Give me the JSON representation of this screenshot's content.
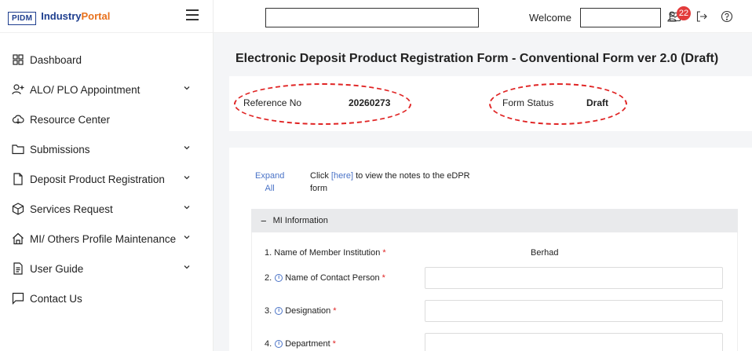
{
  "brand": {
    "logo_prefix": "PIDM",
    "name_part1": "Industry",
    "name_part2": "Portal"
  },
  "header": {
    "welcome_label": "Welcome",
    "notification_count": "22"
  },
  "sidebar": {
    "items": [
      {
        "label": "Dashboard",
        "icon": "grid-icon",
        "has_chevron": false
      },
      {
        "label": "ALO/ PLO Appointment",
        "icon": "add-user-icon",
        "has_chevron": true
      },
      {
        "label": "Resource Center",
        "icon": "cloud-icon",
        "has_chevron": false
      },
      {
        "label": "Submissions",
        "icon": "folder-icon",
        "has_chevron": true
      },
      {
        "label": "Deposit Product Registration",
        "icon": "file-icon",
        "has_chevron": true
      },
      {
        "label": "Services Request",
        "icon": "cube-icon",
        "has_chevron": true
      },
      {
        "label": "MI/ Others Profile Maintenance",
        "icon": "home-icon",
        "has_chevron": true
      },
      {
        "label": "User Guide",
        "icon": "document-icon",
        "has_chevron": true
      },
      {
        "label": "Contact Us",
        "icon": "message-icon",
        "has_chevron": false
      }
    ]
  },
  "main": {
    "title": "Electronic Deposit Product Registration Form - Conventional Form ver 2.0 (Draft)",
    "reference_label": "Reference No",
    "reference_value": "20260273",
    "form_status_label": "Form Status",
    "form_status_value": "Draft",
    "expand_label_1": "Expand",
    "expand_label_2": "All",
    "notes_pre": "Click ",
    "notes_link": "[here]",
    "notes_post": " to view the notes to the eDPR form",
    "section_title": "MI Information",
    "fields": [
      {
        "num": "1.",
        "label": "Name of Member Institution",
        "value": "Berhad",
        "has_info": false
      },
      {
        "num": "2.",
        "label": "Name of Contact Person",
        "value": "",
        "has_info": true
      },
      {
        "num": "3.",
        "label": "Designation",
        "value": "",
        "has_info": true
      },
      {
        "num": "4.",
        "label": "Department",
        "value": "",
        "has_info": true
      }
    ],
    "required_mark": "*"
  },
  "colors": {
    "brand_blue": "#1f3f8f",
    "accent_orange": "#e8711c",
    "link_blue": "#4a73c7",
    "annotation_red": "#e02424",
    "badge_red": "#e23b3b"
  }
}
